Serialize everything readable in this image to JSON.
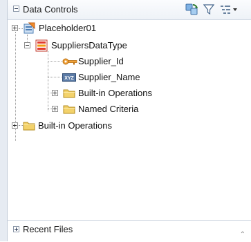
{
  "panel": {
    "title": "Data Controls",
    "toolbar": {
      "refresh_icon": "refresh-icon",
      "filter_icon": "filter-icon",
      "options_icon": "tree-options-icon"
    }
  },
  "tree": {
    "root": {
      "label": "Placeholder01",
      "icon": "placeholder-datacontrol-icon"
    },
    "data_type": {
      "label": "SuppliersDataType",
      "icon": "data-type-icon"
    },
    "attributes": [
      {
        "label": "Supplier_Id",
        "icon": "key-attribute-icon"
      },
      {
        "label": "Supplier_Name",
        "icon": "text-attribute-icon"
      }
    ],
    "child_folders": [
      {
        "label": "Built-in Operations",
        "icon": "folder-icon"
      },
      {
        "label": "Named Criteria",
        "icon": "folder-icon"
      }
    ],
    "root_folder": {
      "label": "Built-in Operations",
      "icon": "folder-icon"
    }
  },
  "footer": {
    "title": "Recent Files"
  },
  "colors": {
    "accent": "#e67e22",
    "folder": "#f3d26b",
    "data_type": "#e23b2e"
  }
}
